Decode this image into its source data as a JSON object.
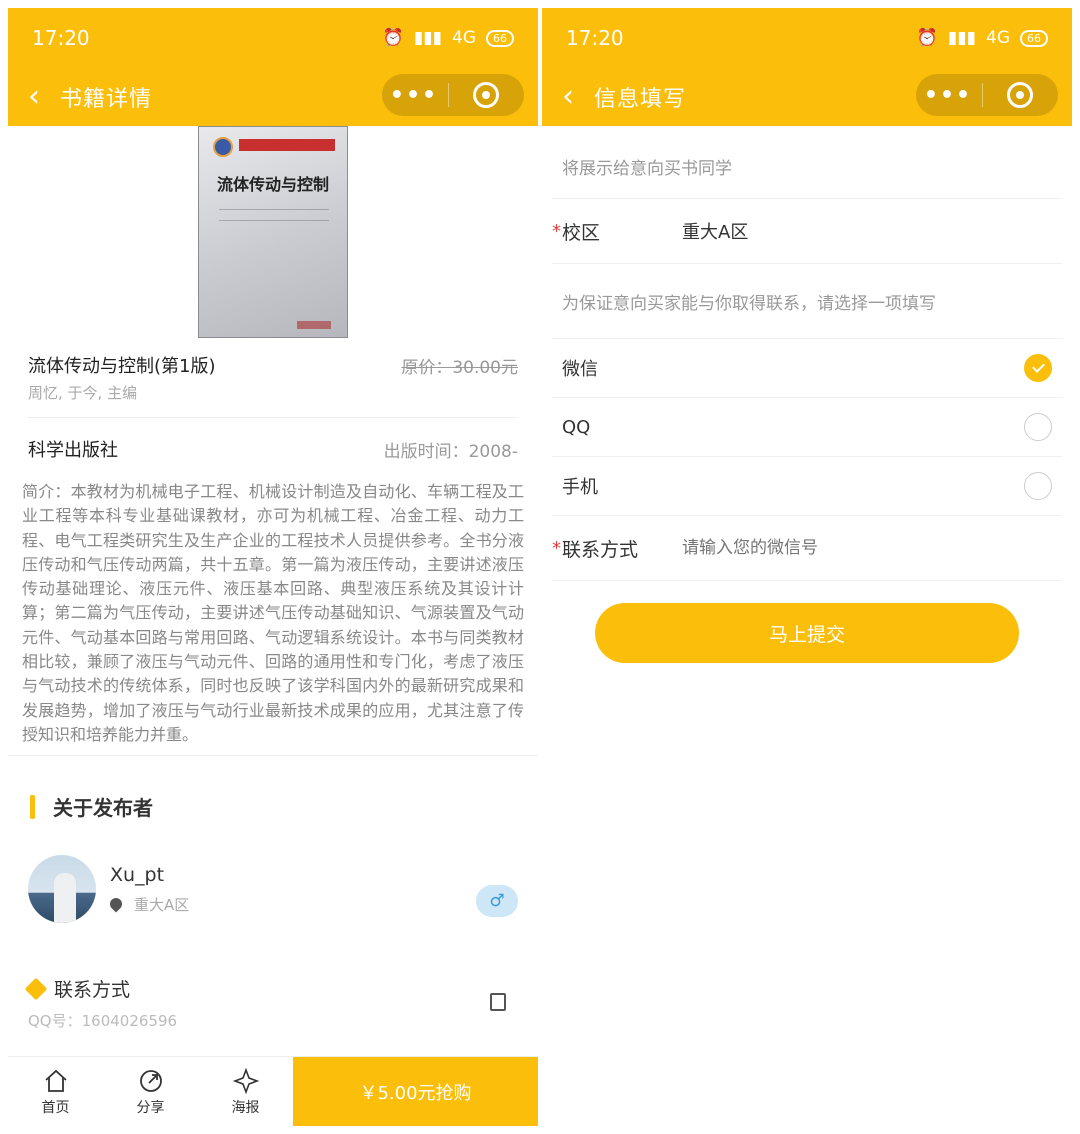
{
  "status": {
    "time": "17:20",
    "network": "4G",
    "battery": "66"
  },
  "left": {
    "nav_title": "书籍详情",
    "book": {
      "cover_title": "流体传动与控制",
      "name": "流体传动与控制(第1版)",
      "orig_price": "原价：30.00元",
      "author": "周忆, 于今, 主编",
      "publisher": "科学出版社",
      "pub_time": "出版时间：2008-",
      "intro": "简介：本教材为机械电子工程、机械设计制造及自动化、车辆工程及工业工程等本科专业基础课教材，亦可为机械工程、冶金工程、动力工程、电气工程类研究生及生产企业的工程技术人员提供参考。全书分液压传动和气压传动两篇，共十五章。第一篇为液压传动，主要讲述液压传动基础理论、液压元件、液压基本回路、典型液压系统及其设计计算；第二篇为气压传动，主要讲述气压传动基础知识、气源装置及气动元件、气动基本回路与常用回路、气动逻辑系统设计。本书与同类教材相比较，兼顾了液压与气动元件、回路的通用性和专门化，考虑了液压与气动技术的传统体系，同时也反映了该学科国内外的最新研究成果和发展趋势，增加了液压与气动行业最新技术成果的应用，尤其注意了传授知识和培养能力并重。"
    },
    "about_title": "关于发布者",
    "publisher_user": {
      "name": "Xu_pt",
      "location": "重大A区",
      "gender": "♂"
    },
    "contact_title": "联系方式",
    "qq_line": "QQ号：1604026596",
    "tabs": [
      {
        "label": "首页",
        "icon": "home-icon"
      },
      {
        "label": "分享",
        "icon": "share-icon"
      },
      {
        "label": "海报",
        "icon": "poster-icon"
      }
    ],
    "buy_label": "￥5.00元抢购"
  },
  "right": {
    "nav_title": "信息填写",
    "hint_display": "将展示给意向买书同学",
    "campus_label": "校区",
    "campus_value": "重大A区",
    "hint_contact": "为保证意向买家能与你取得联系，请选择一项填写",
    "options": [
      {
        "label": "微信",
        "selected": true
      },
      {
        "label": "QQ",
        "selected": false
      },
      {
        "label": "手机",
        "selected": false
      }
    ],
    "contact_label": "联系方式",
    "contact_placeholder": "请输入您的微信号",
    "submit_label": "马上提交"
  },
  "colors": {
    "accent": "#FBBE0B",
    "required": "#E64340"
  }
}
